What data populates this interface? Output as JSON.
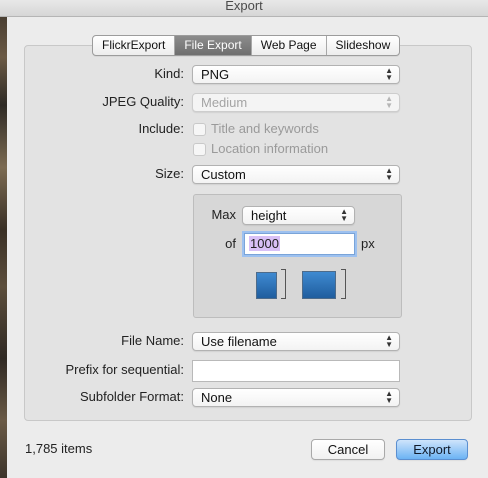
{
  "window": {
    "title": "Export"
  },
  "tabs": [
    {
      "label": "FlickrExport",
      "active": false
    },
    {
      "label": "File Export",
      "active": true
    },
    {
      "label": "Web Page",
      "active": false
    },
    {
      "label": "Slideshow",
      "active": false
    }
  ],
  "kind": {
    "label": "Kind:",
    "value": "PNG"
  },
  "jpeg_quality": {
    "label": "JPEG Quality:",
    "value": "Medium",
    "disabled": true
  },
  "include": {
    "label": "Include:",
    "options": [
      {
        "label": "Title and keywords",
        "checked": false,
        "disabled": true
      },
      {
        "label": "Location information",
        "checked": false,
        "disabled": true
      }
    ]
  },
  "size": {
    "label": "Size:",
    "value": "Custom"
  },
  "custom_size": {
    "max_label": "Max",
    "dimension": "height",
    "of_label": "of",
    "value": "1000",
    "unit": "px"
  },
  "file_name": {
    "label": "File Name:",
    "value": "Use filename"
  },
  "prefix": {
    "label": "Prefix for sequential:",
    "value": ""
  },
  "subfolder": {
    "label": "Subfolder Format:",
    "value": "None"
  },
  "footer": {
    "item_count": "1,785 items",
    "cancel_label": "Cancel",
    "export_label": "Export"
  },
  "colors": {
    "accent": "#5b8fd0",
    "selection": "#d8c0f6",
    "focus_ring": "#9dc1f0"
  }
}
